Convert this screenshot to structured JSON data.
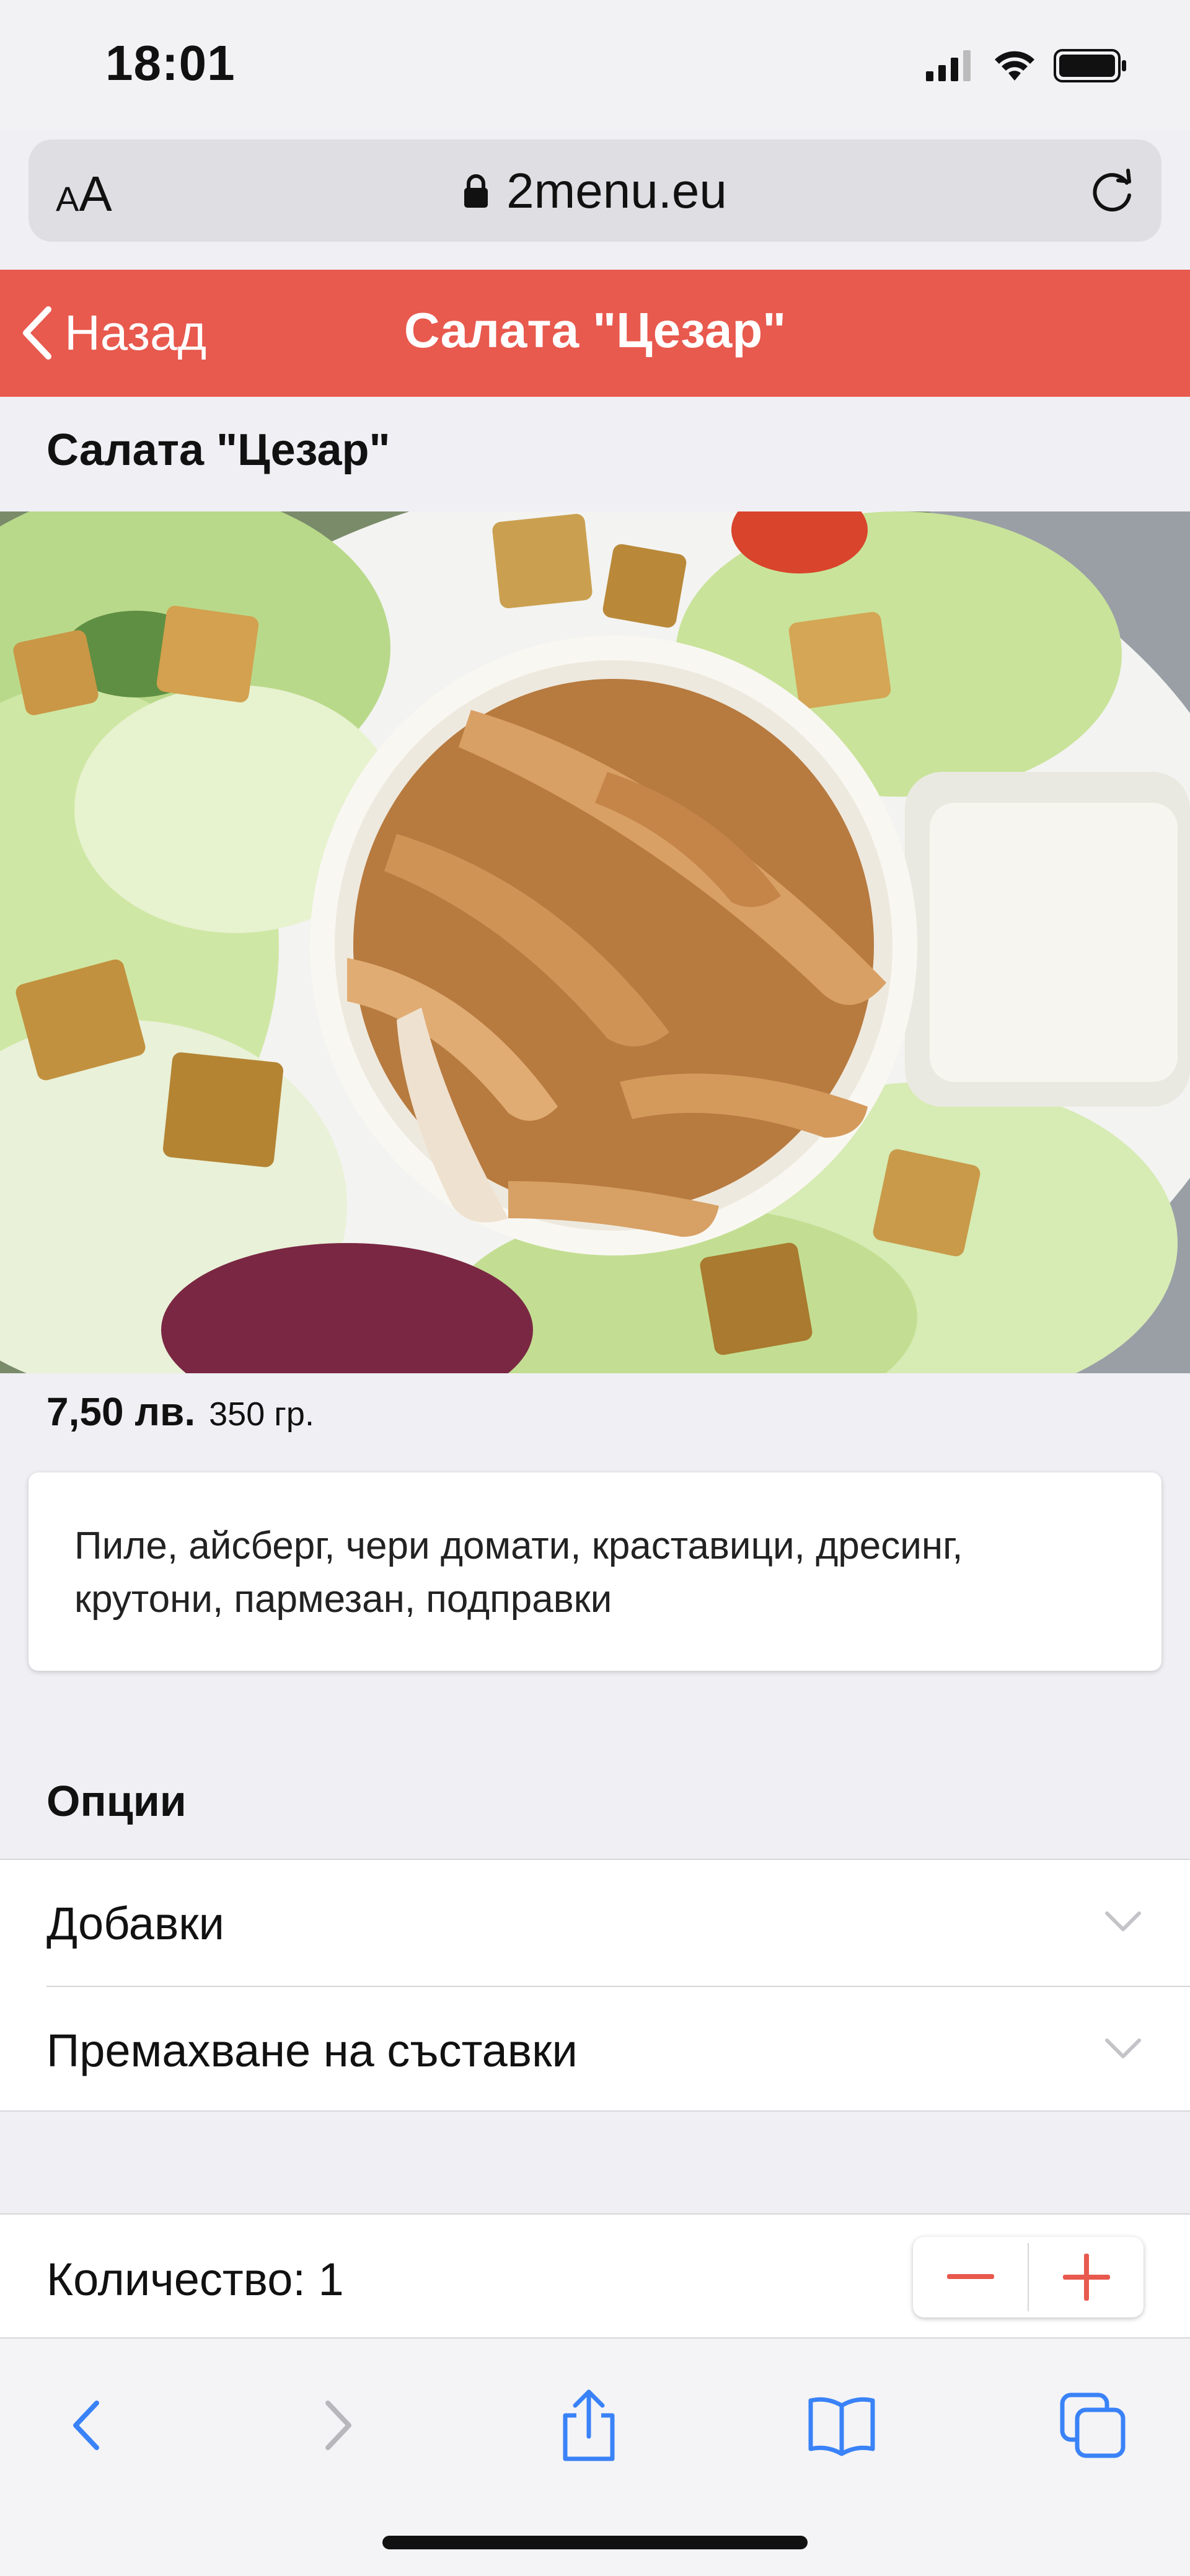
{
  "status_bar": {
    "time": "18:01",
    "icons": [
      "signal-icon",
      "wifi-icon",
      "battery-icon"
    ]
  },
  "address_bar": {
    "aa_small": "A",
    "aa_large": "A",
    "url": "2menu.eu",
    "icons": [
      "lock-icon",
      "reload-icon"
    ]
  },
  "nav": {
    "back_label": "Назад",
    "title": "Салата \"Цезар\""
  },
  "product": {
    "name": "Салата \"Цезар\"",
    "price": "7,50 лв.",
    "weight": "350 гр.",
    "description": "Пиле, айсберг, чери домати, краставици, дресинг, крутони, пармезан, подправки"
  },
  "options": {
    "heading": "Опции",
    "items": [
      {
        "label": "Добавки"
      },
      {
        "label": "Премахване на съставки"
      }
    ]
  },
  "quantity": {
    "label": "Количество: 1"
  },
  "colors": {
    "accent": "#e8594e",
    "ios_blue": "#3a82f7",
    "background": "#efeff4"
  },
  "toolbar": {
    "icons": [
      "back-arrow-icon",
      "forward-arrow-icon",
      "share-icon",
      "bookmarks-icon",
      "tabs-icon"
    ]
  }
}
